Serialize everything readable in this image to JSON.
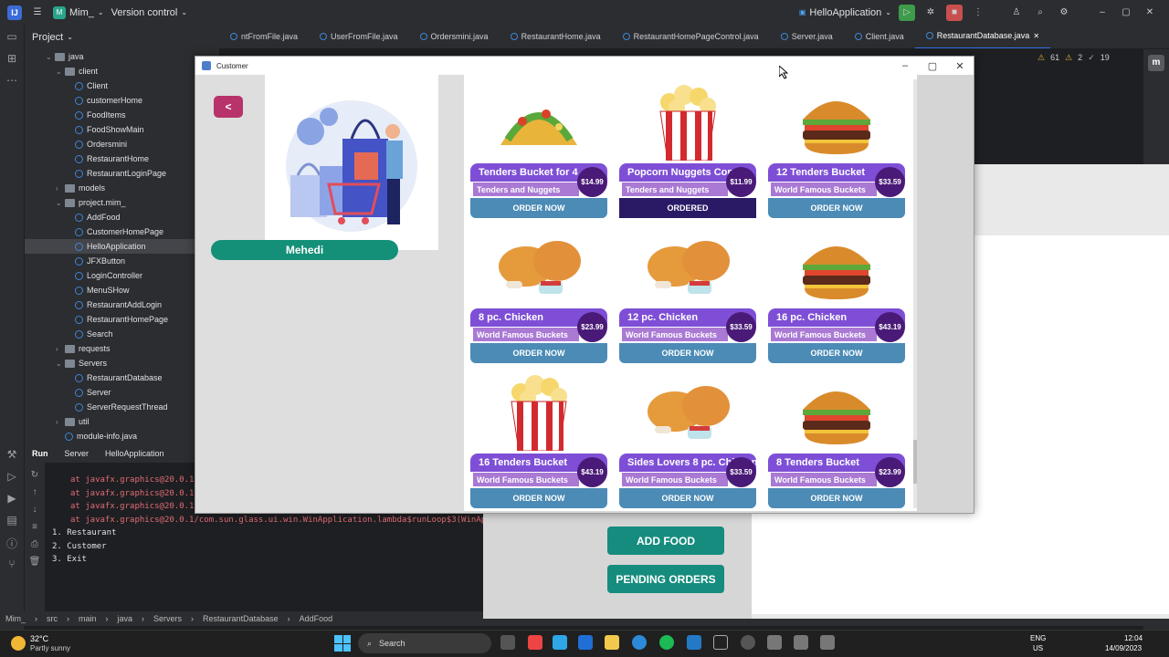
{
  "ide": {
    "project_name": "Mim_",
    "vcs_label": "Version control",
    "run_config": "HelloApplication",
    "project_label": "Project",
    "warnings": "61",
    "weak_warnings": "2",
    "infos": "19"
  },
  "tabs": [
    "ntFromFile.java",
    "UserFromFile.java",
    "Ordersmini.java",
    "RestaurantHome.java",
    "RestaurantHomePageControl.java",
    "Server.java",
    "Client.java",
    "RestaurantDatabase.java"
  ],
  "tree": [
    {
      "label": "java",
      "indent": 3,
      "kind": "folder",
      "arrow": "v"
    },
    {
      "label": "client",
      "indent": 4,
      "kind": "folder",
      "arrow": "v"
    },
    {
      "label": "Client",
      "indent": 5,
      "kind": "class"
    },
    {
      "label": "customerHome",
      "indent": 5,
      "kind": "class"
    },
    {
      "label": "FoodItems",
      "indent": 5,
      "kind": "class"
    },
    {
      "label": "FoodShowMain",
      "indent": 5,
      "kind": "class"
    },
    {
      "label": "Ordersmini",
      "indent": 5,
      "kind": "class"
    },
    {
      "label": "RestaurantHome",
      "indent": 5,
      "kind": "class"
    },
    {
      "label": "RestaurantLoginPage",
      "indent": 5,
      "kind": "class"
    },
    {
      "label": "models",
      "indent": 4,
      "kind": "folder",
      "arrow": ">"
    },
    {
      "label": "project.mim_",
      "indent": 4,
      "kind": "folder",
      "arrow": "v"
    },
    {
      "label": "AddFood",
      "indent": 5,
      "kind": "class"
    },
    {
      "label": "CustomerHomePage",
      "indent": 5,
      "kind": "class"
    },
    {
      "label": "HelloApplication",
      "indent": 5,
      "kind": "class",
      "selected": true
    },
    {
      "label": "JFXButton",
      "indent": 5,
      "kind": "class"
    },
    {
      "label": "LoginController",
      "indent": 5,
      "kind": "class"
    },
    {
      "label": "MenuSHow",
      "indent": 5,
      "kind": "class"
    },
    {
      "label": "RestaurantAddLogin",
      "indent": 5,
      "kind": "class"
    },
    {
      "label": "RestaurantHomePage",
      "indent": 5,
      "kind": "class"
    },
    {
      "label": "Search",
      "indent": 5,
      "kind": "class"
    },
    {
      "label": "requests",
      "indent": 4,
      "kind": "folder",
      "arrow": ">"
    },
    {
      "label": "Servers",
      "indent": 4,
      "kind": "folder",
      "arrow": "v"
    },
    {
      "label": "RestaurantDatabase",
      "indent": 5,
      "kind": "class"
    },
    {
      "label": "Server",
      "indent": 5,
      "kind": "class"
    },
    {
      "label": "ServerRequestThread",
      "indent": 5,
      "kind": "class"
    },
    {
      "label": "util",
      "indent": 4,
      "kind": "folder",
      "arrow": ">"
    },
    {
      "label": "module-info.java",
      "indent": 4,
      "kind": "class"
    }
  ],
  "run": {
    "label": "Run",
    "tabs": [
      "Server",
      "HelloApplication"
    ],
    "console": [
      {
        "text": "at javafx.graphics@20.0.1/",
        "type": "err"
      },
      {
        "text": "at javafx.graphics@20.0.1/",
        "type": "err"
      },
      {
        "text": "at javafx.graphics@20.0.1/com.sun.glass.ui.win.WinApplication._runLoop(Native Metho",
        "type": "err"
      },
      {
        "text": "at javafx.graphics@20.0.1/com.sun.glass.ui.win.WinApplication.lambda$runLoop$3(WinApp",
        "type": "err"
      },
      {
        "text": "1. Restaurant",
        "type": "out"
      },
      {
        "text": "2. Customer",
        "type": "out"
      },
      {
        "text": "3. Exit",
        "type": "out"
      }
    ]
  },
  "breadcrumb": [
    "Mim_",
    "src",
    "main",
    "java",
    "Servers",
    "RestaurantDatabase",
    "AddFood"
  ],
  "restaurant": {
    "add_food": "ADD FOOD",
    "pending_orders": "PENDING ORDERS"
  },
  "customer": {
    "window_title": "Customer",
    "back_label": "<",
    "user_name": "Mehedi",
    "items": [
      {
        "name": "Tenders Bucket for 4",
        "category": "Tenders and Nuggets",
        "price": "$14.99",
        "img": "taco",
        "action": "ORDER NOW",
        "ordered": false
      },
      {
        "name": "Popcorn Nuggets Combo",
        "category": "Tenders and Nuggets",
        "price": "$11.99",
        "img": "popcorn",
        "action": "ORDERED",
        "ordered": true
      },
      {
        "name": "12 Tenders Bucket",
        "category": "World Famous Buckets",
        "price": "$33.59",
        "img": "burger",
        "action": "ORDER NOW",
        "ordered": false
      },
      {
        "name": "8 pc. Chicken",
        "category": "World Famous Buckets",
        "price": "$23.99",
        "img": "chicken",
        "action": "ORDER NOW",
        "ordered": false
      },
      {
        "name": "12 pc. Chicken",
        "category": "World Famous Buckets",
        "price": "$33.59",
        "img": "chicken",
        "action": "ORDER NOW",
        "ordered": false
      },
      {
        "name": "16 pc. Chicken",
        "category": "World Famous Buckets",
        "price": "$43.19",
        "img": "burger",
        "action": "ORDER NOW",
        "ordered": false
      },
      {
        "name": "16 Tenders Bucket",
        "category": "World Famous Buckets",
        "price": "$43.19",
        "img": "popcorn",
        "action": "ORDER NOW",
        "ordered": false
      },
      {
        "name": "Sides Lovers 8 pc. Chicken",
        "category": "World Famous Buckets",
        "price": "$33.59",
        "img": "chicken",
        "action": "ORDER NOW",
        "ordered": false
      },
      {
        "name": "8 Tenders Bucket",
        "category": "World Famous Buckets",
        "price": "$23.99",
        "img": "burger",
        "action": "ORDER NOW",
        "ordered": false
      }
    ]
  },
  "taskbar": {
    "weather_temp": "32°C",
    "weather_desc": "Partly sunny",
    "search_label": "Search",
    "lang": "ENG",
    "region": "US",
    "time": "12:04",
    "date": "14/09/2023"
  }
}
